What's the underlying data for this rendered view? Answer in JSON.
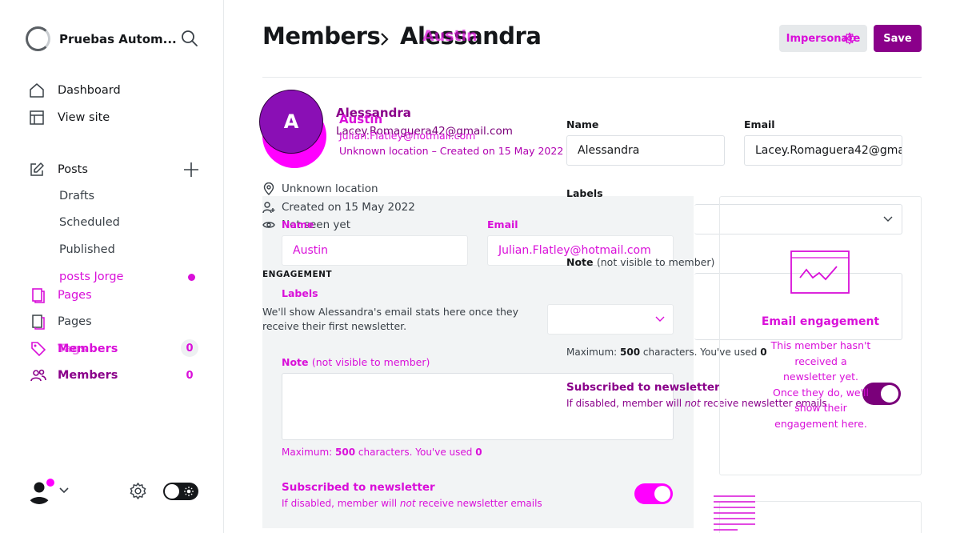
{
  "sidebar": {
    "site_name": "Pruebas Autom...",
    "nav": {
      "dashboard": "Dashboard",
      "view_site": "View site",
      "posts": "Posts",
      "drafts": "Drafts",
      "scheduled": "Scheduled",
      "published": "Published",
      "posts_jorge": "posts Jorge",
      "pages_ghost": "Pages",
      "pages": "Pages",
      "tags_ghost": "Tags",
      "members_ghost": "Members",
      "members_ghost_count": "0",
      "members": "Members",
      "members_count": "0"
    }
  },
  "header": {
    "breadcrumb_parent": "Members",
    "breadcrumb_current": "Alessandra",
    "breadcrumb_ghost": "Austin",
    "impersonate_label": "Impersonate",
    "save_label": "Save"
  },
  "member": {
    "initial": "A",
    "name": "Alessandra",
    "email": "Lacey.Romaguera42@gmail.com",
    "ghost_name": "Austin",
    "ghost_email": "Julian.Flatley@hotmail.com",
    "ghost_meta": "Unknown location – Created on 15 May 2022",
    "location": "Unknown location",
    "created": "Created on 15 May 2022",
    "last_seen": "Not seen yet"
  },
  "engagement": {
    "section_label": "ENGAGEMENT",
    "stats_text": "We'll show Alessandra's email stats here once they receive their first newsletter.",
    "card_title": "Email engagement",
    "card_desc": "This member hasn't received a newsletter yet. Once they do, we'll show their engagement here."
  },
  "ghost_form": {
    "name_label": "Name",
    "name_value": "Austin",
    "email_label": "Email",
    "email_value": "Julian.Flatley@hotmail.com",
    "labels_label": "Labels",
    "note_label": "Note",
    "note_hint": "(not visible to member)",
    "max_prefix": "Maximum:",
    "max_value": "500",
    "max_suffix": "characters. You've used",
    "used": "0",
    "subscribed_label": "Subscribed to newsletter",
    "subscribed_hint_pre": "If disabled, member will",
    "subscribed_hint_not": "not",
    "subscribed_hint_post": "receive newsletter emails"
  },
  "form": {
    "name_label": "Name",
    "name_value": "Alessandra",
    "email_label": "Email",
    "email_value": "Lacey.Romaguera42@gmail.com",
    "labels_label": "Labels",
    "note_label": "Note",
    "note_hint": "(not visible to member)",
    "max_prefix": "Maximum:",
    "max_value": "500",
    "max_suffix": "characters. You've used",
    "used": "0",
    "subscribed_label": "Subscribed to newsletter",
    "subscribed_hint_pre": "If disabled, member will",
    "subscribed_hint_not": "not",
    "subscribed_hint_post": "receive newsletter emails",
    "subscribed": true
  },
  "colors": {
    "accent": "#8a008a",
    "ghost": "#d90fd9",
    "avatar": "#8a0fb5"
  }
}
